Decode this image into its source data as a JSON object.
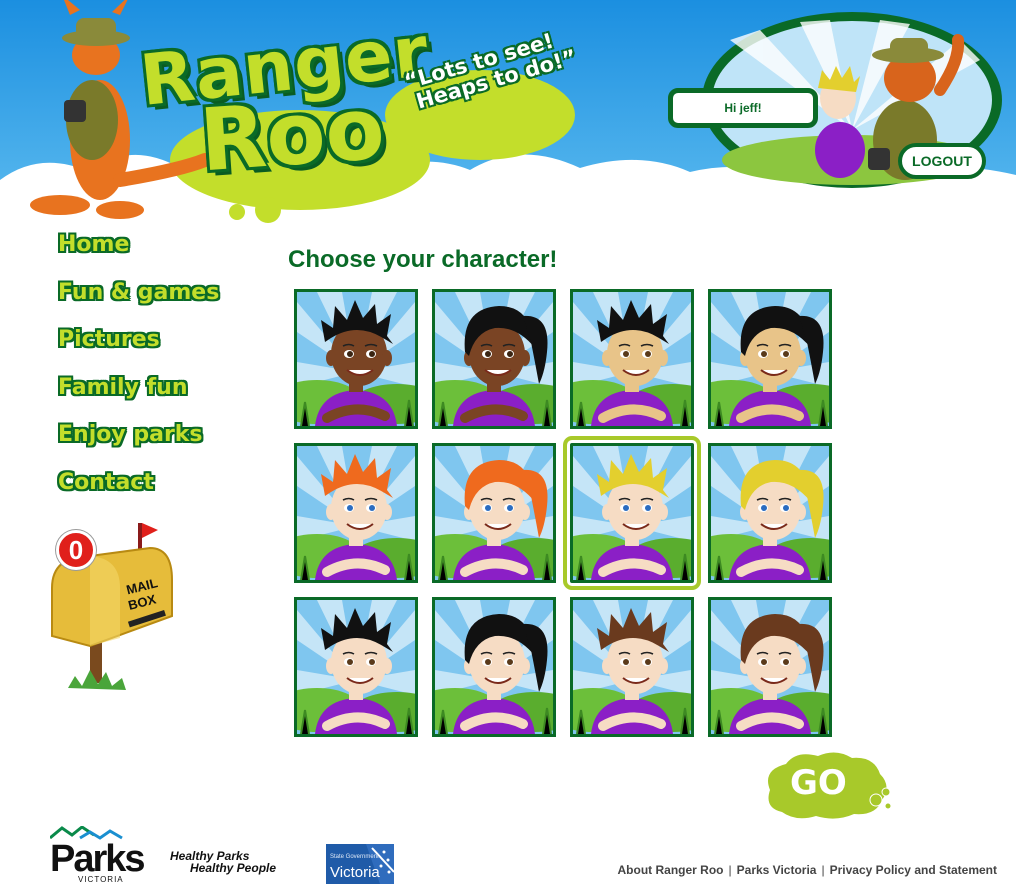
{
  "header": {
    "logo_line1": "Ranger",
    "logo_line2": "Roo",
    "tagline_line1": "“Lots to see!",
    "tagline_line2": "Heaps to do!”",
    "greeting": "Hi jeff!",
    "logout_label": "LOGOUT"
  },
  "nav": {
    "items": [
      {
        "label": "Home"
      },
      {
        "label": "Fun & games"
      },
      {
        "label": "Pictures"
      },
      {
        "label": "Family fun"
      },
      {
        "label": "Enjoy parks"
      },
      {
        "label": "Contact"
      }
    ]
  },
  "mailbox": {
    "count": "0",
    "label_line1": "MAIL",
    "label_line2": "BOX"
  },
  "main": {
    "title": "Choose your character!",
    "selected_index": 6,
    "characters": [
      {
        "skin": "#7a4424",
        "hair": "#111111",
        "style": "spiky",
        "eyes": "#3a2412"
      },
      {
        "skin": "#7a4424",
        "hair": "#111111",
        "style": "ponytail",
        "eyes": "#3a2412"
      },
      {
        "skin": "#e8c489",
        "hair": "#111111",
        "style": "spiky",
        "eyes": "#5a3a1a"
      },
      {
        "skin": "#e8c489",
        "hair": "#111111",
        "style": "ponytail",
        "eyes": "#5a3a1a"
      },
      {
        "skin": "#f6dcc4",
        "hair": "#ef6a1e",
        "style": "spiky",
        "eyes": "#2b6cc0"
      },
      {
        "skin": "#f6dcc4",
        "hair": "#ef6a1e",
        "style": "ponytail",
        "eyes": "#2b6cc0"
      },
      {
        "skin": "#f6dcc4",
        "hair": "#e3cf2e",
        "style": "spiky",
        "eyes": "#2b6cc0"
      },
      {
        "skin": "#f6dcc4",
        "hair": "#e3cf2e",
        "style": "ponytail",
        "eyes": "#2b6cc0"
      },
      {
        "skin": "#f6dcc4",
        "hair": "#111111",
        "style": "spiky",
        "eyes": "#5a3a1a"
      },
      {
        "skin": "#f6dcc4",
        "hair": "#111111",
        "style": "ponytail",
        "eyes": "#5a3a1a"
      },
      {
        "skin": "#f6dcc4",
        "hair": "#6a3a1e",
        "style": "spiky",
        "eyes": "#5a3a1a"
      },
      {
        "skin": "#f6dcc4",
        "hair": "#6a3a1e",
        "style": "ponytail",
        "eyes": "#5a3a1a"
      }
    ],
    "go_label": "GO"
  },
  "footer": {
    "parks_word": "Parks",
    "parks_sub": "VICTORIA",
    "healthy_line1": "Healthy Parks",
    "healthy_line2": "Healthy People",
    "vic_small": "State Government",
    "vic_word": "Victoria",
    "links": [
      "About Ranger Roo",
      "Parks Victoria",
      "Privacy Policy and Statement"
    ]
  },
  "colors": {
    "brand_green": "#0a6a27",
    "lime": "#c3de2b",
    "sky": "#2aa0e6",
    "shirt": "#8b1fc6"
  }
}
